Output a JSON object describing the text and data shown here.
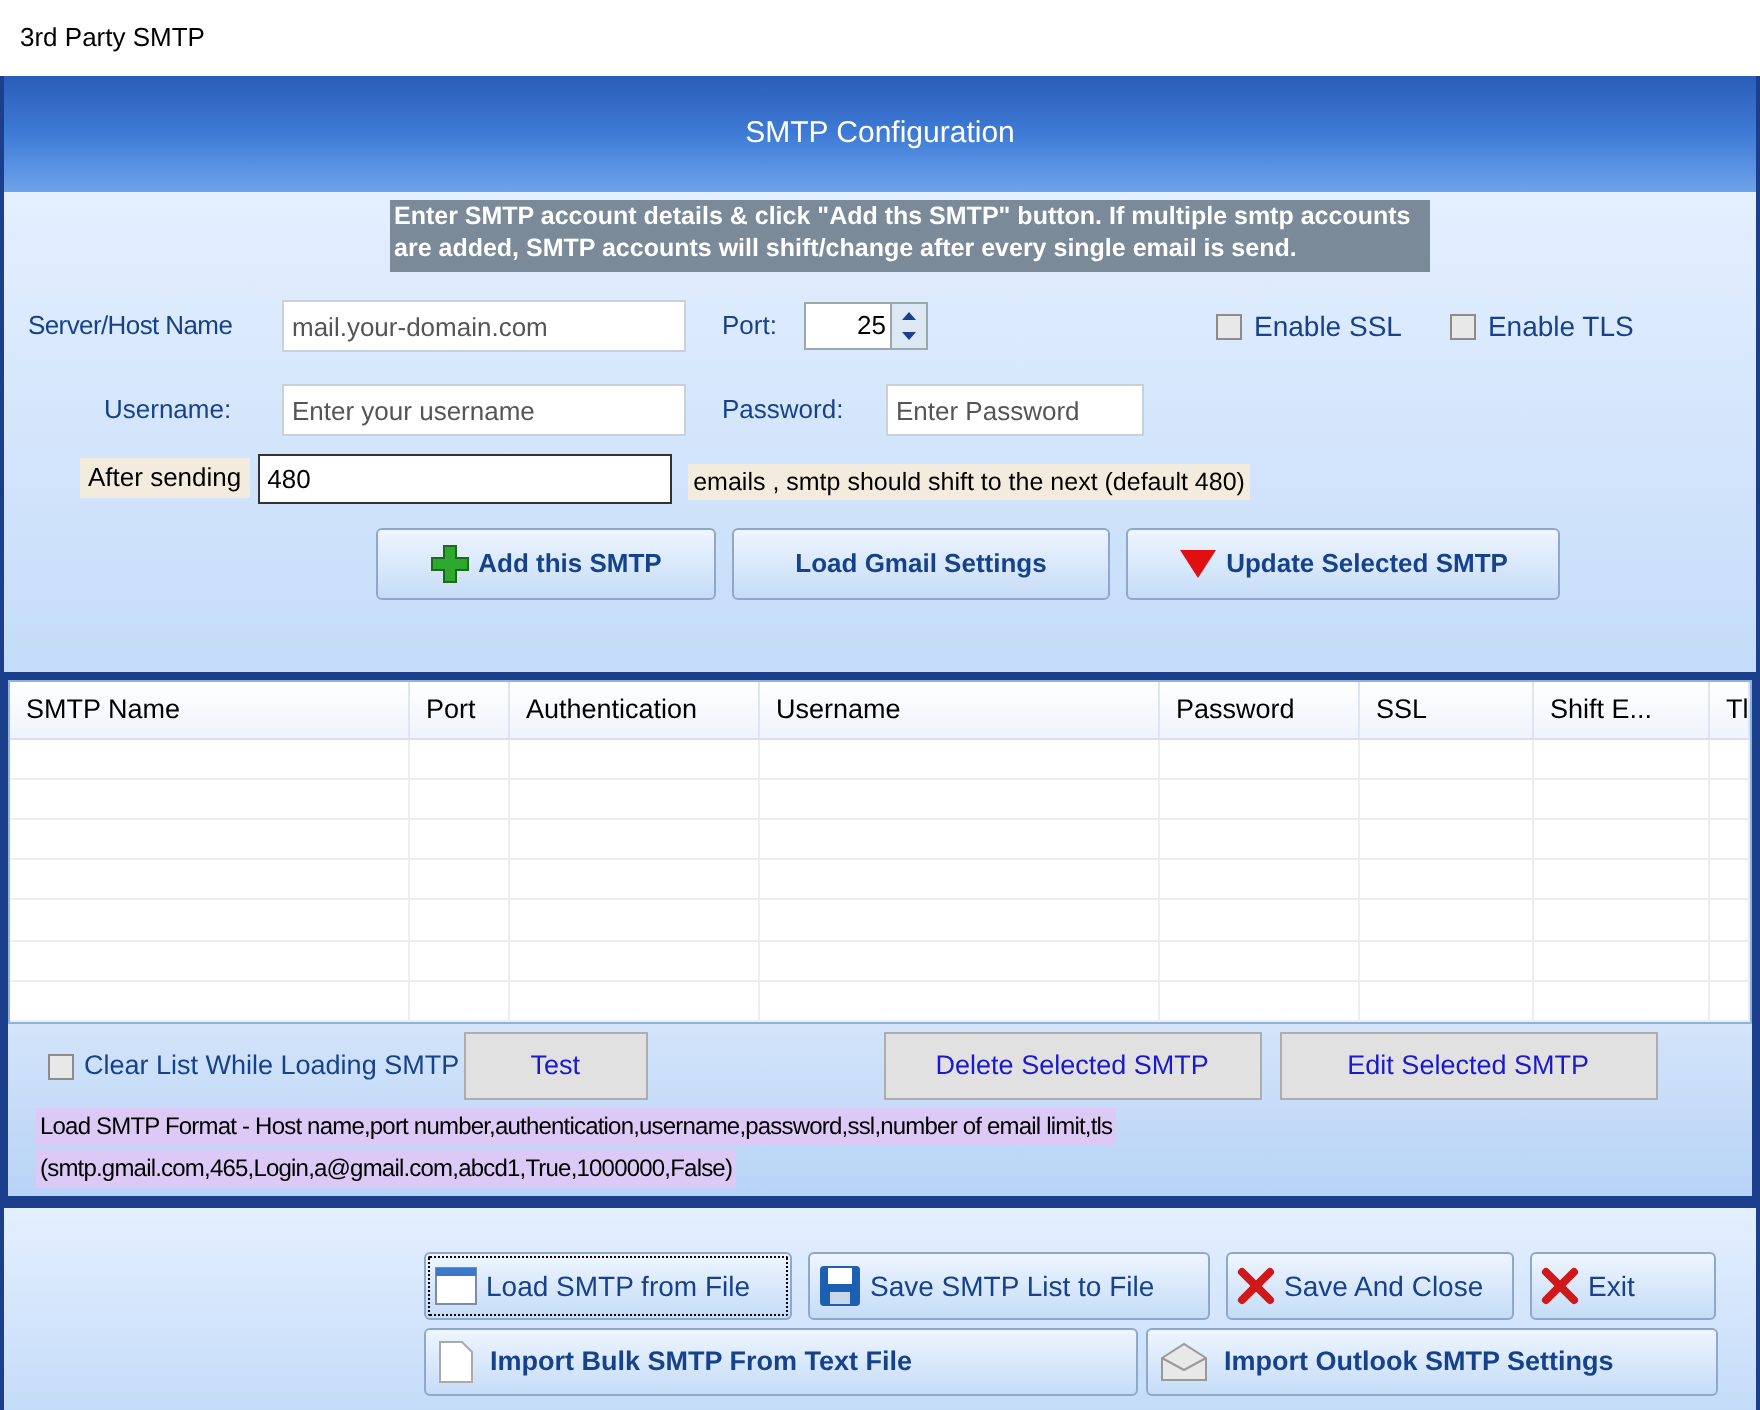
{
  "window": {
    "title": "3rd Party SMTP"
  },
  "header": {
    "title": "SMTP Configuration"
  },
  "notice": "Enter SMTP account details & click \"Add ths SMTP\" button. If multiple smtp accounts are added, SMTP accounts will shift/change after every single email is send.",
  "server": {
    "label": "Server/Host Name",
    "placeholder": "mail.your-domain.com"
  },
  "port": {
    "label": "Port:",
    "value": "25"
  },
  "options": [
    {
      "label": "Enable SSL",
      "checked": false
    },
    {
      "label": "Enable TLS",
      "checked": false
    }
  ],
  "username": {
    "label": "Username:",
    "placeholder": "Enter your username"
  },
  "password": {
    "label": "Password:",
    "placeholder": "Enter Password"
  },
  "after_sending": {
    "label": "After sending",
    "value": "480",
    "suffix": "emails , smtp should shift to the next (default 480)"
  },
  "actions": [
    {
      "label": "Add this SMTP",
      "kind": "add"
    },
    {
      "label": "Load Gmail Settings",
      "kind": "plain"
    },
    {
      "label": "Update Selected SMTP",
      "kind": "update"
    }
  ],
  "table": {
    "columns": [
      "SMTP Name",
      "Port",
      "Authentication",
      "Username",
      "Password",
      "SSL",
      "Shift E...",
      "Tl"
    ]
  },
  "clear_list": {
    "label": "Clear List While Loading SMTP",
    "checked": false
  },
  "list_buttons": [
    "Test",
    "Delete Selected SMTP",
    "Edit Selected SMTP"
  ],
  "format_lines": [
    "Load SMTP Format - Host name,port number,authentication,username,password,ssl,number of email limit,tls",
    "(smtp.gmail.com,465,Login,a@gmail.com,abcd1,True,1000000,False)"
  ],
  "footer_buttons": [
    {
      "label": "Load SMTP from File",
      "kind": "window",
      "focused": true
    },
    {
      "label": "Save SMTP List to File",
      "kind": "disk",
      "focused": false
    },
    {
      "label": "Save And Close",
      "kind": "cross",
      "focused": false
    },
    {
      "label": "Exit",
      "kind": "cross",
      "focused": false
    }
  ],
  "import_buttons": [
    {
      "label": "Import Bulk SMTP From Text File",
      "kind": "page"
    },
    {
      "label": "Import Outlook SMTP Settings",
      "kind": "envelope"
    }
  ]
}
